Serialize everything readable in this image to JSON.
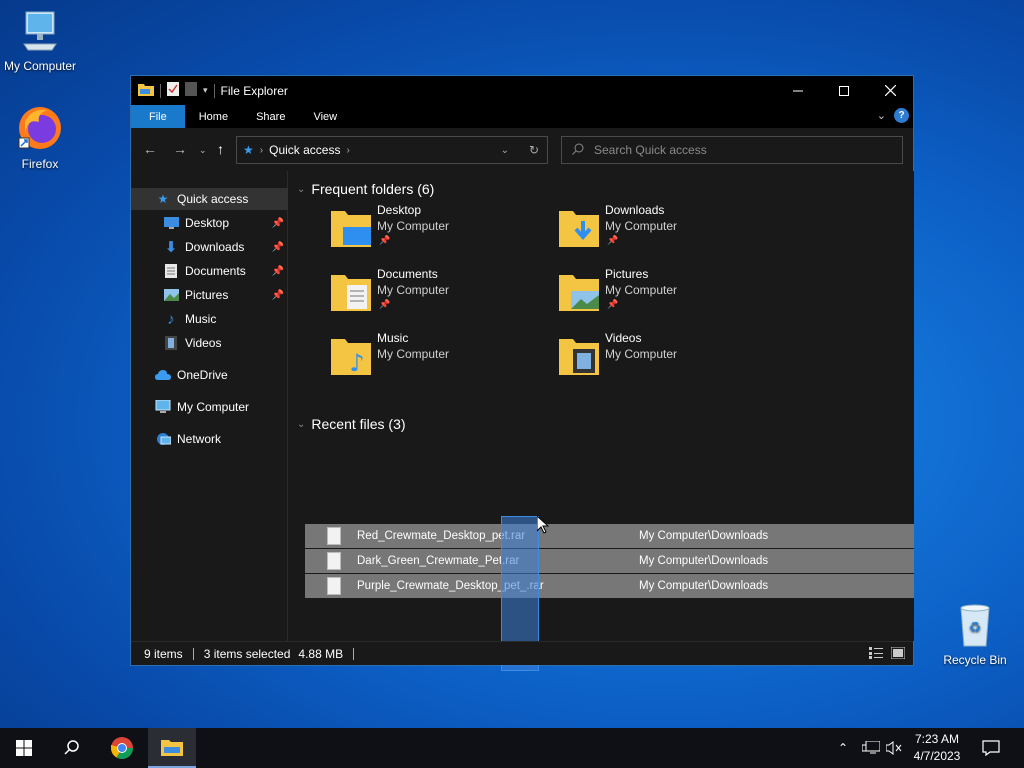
{
  "desktop": {
    "icons": [
      {
        "label": "My Computer"
      },
      {
        "label": "Firefox"
      },
      {
        "label": "Recycle Bin"
      }
    ]
  },
  "window": {
    "title": "File Explorer",
    "ribbon_tabs": [
      "File",
      "Home",
      "Share",
      "View"
    ],
    "help_label": "?",
    "address": {
      "location": "Quick access"
    },
    "search": {
      "placeholder": "Search Quick access"
    }
  },
  "sidebar": {
    "items": [
      {
        "label": "Quick access",
        "icon": "star-icon",
        "pinned": false
      },
      {
        "label": "Desktop",
        "icon": "desktop-icon",
        "pinned": true
      },
      {
        "label": "Downloads",
        "icon": "download-arrow-icon",
        "pinned": true
      },
      {
        "label": "Documents",
        "icon": "document-icon",
        "pinned": true
      },
      {
        "label": "Pictures",
        "icon": "picture-icon",
        "pinned": true
      },
      {
        "label": "Music",
        "icon": "music-note-icon",
        "pinned": false
      },
      {
        "label": "Videos",
        "icon": "film-icon",
        "pinned": false
      },
      {
        "label": "OneDrive",
        "icon": "cloud-icon",
        "pinned": false
      },
      {
        "label": "My Computer",
        "icon": "computer-icon",
        "pinned": false
      },
      {
        "label": "Network",
        "icon": "network-icon",
        "pinned": false
      }
    ]
  },
  "content": {
    "frequent_header": "Frequent folders (6)",
    "recent_header": "Recent files (3)",
    "folders": [
      {
        "name": "Desktop",
        "location": "My Computer",
        "pinned": true
      },
      {
        "name": "Downloads",
        "location": "My Computer",
        "pinned": true
      },
      {
        "name": "Documents",
        "location": "My Computer",
        "pinned": true
      },
      {
        "name": "Pictures",
        "location": "My Computer",
        "pinned": true
      },
      {
        "name": "Music",
        "location": "My Computer",
        "pinned": false
      },
      {
        "name": "Videos",
        "location": "My Computer",
        "pinned": false
      }
    ],
    "recent_files": [
      {
        "name": "Red_Crewmate_Desktop_pet.rar",
        "path": "My Computer\\Downloads"
      },
      {
        "name": "Dark_Green_Crewmate_Pet.rar",
        "path": "My Computer\\Downloads"
      },
      {
        "name": "Purple_Crewmate_Desktop_pet_.rar",
        "path": "My Computer\\Downloads"
      }
    ]
  },
  "status": {
    "items_count": "9 items",
    "selected": "3 items selected",
    "size": "4.88 MB"
  },
  "taskbar": {
    "time": "7:23 AM",
    "date": "4/7/2023"
  },
  "colors": {
    "accent": "#1979ca",
    "window_bg": "#191919",
    "selection_row": "#777777",
    "folder_yellow": "#f4c542"
  }
}
